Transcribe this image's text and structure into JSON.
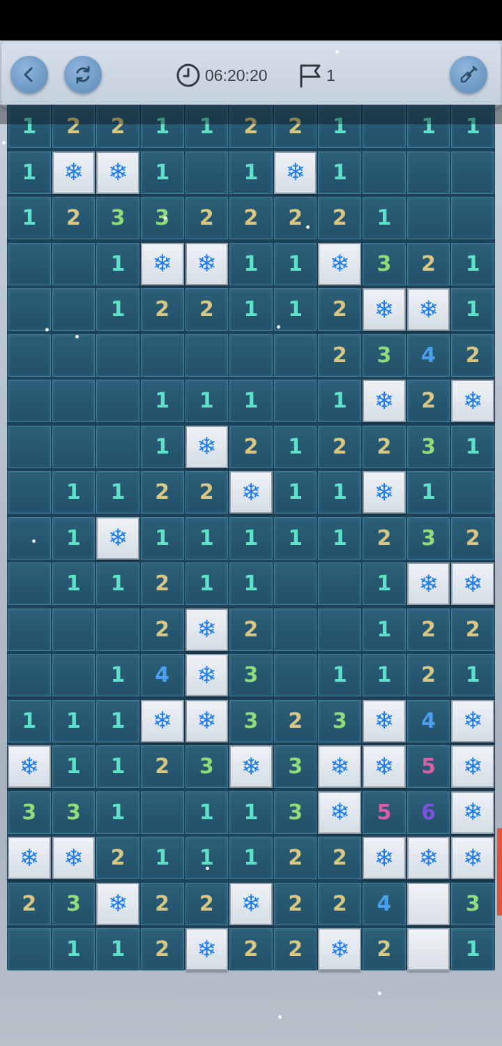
{
  "toolbar": {
    "back_icon": "chevron-left-icon",
    "restart_icon": "refresh-icon",
    "timer_icon": "clock-icon",
    "timer": "06:20:20",
    "flag_icon": "flag-icon",
    "flag_count": "1",
    "tool_icon": "shovel-icon"
  },
  "board": {
    "columns": 11,
    "mine_symbol": "❄",
    "number_colors": {
      "1": "#5fe0c8",
      "2": "#d8c783",
      "3": "#8fdc7a",
      "4": "#4aa0ef",
      "5": "#d95fa6",
      "6": "#7b52df"
    },
    "rows": [
      [
        "1",
        "2",
        "2",
        "1",
        "1",
        "2",
        "2",
        "1",
        "",
        "1",
        "1"
      ],
      [
        "1",
        "M",
        "M",
        "1",
        "",
        "1",
        "M",
        "1",
        "",
        "",
        ""
      ],
      [
        "1",
        "2",
        "3",
        "3",
        "2",
        "2",
        "2",
        "2",
        "1",
        "",
        ""
      ],
      [
        "",
        "",
        "1",
        "M",
        "M",
        "1",
        "1",
        "M",
        "3",
        "2",
        "1"
      ],
      [
        "",
        "",
        "1",
        "2",
        "2",
        "1",
        "1",
        "2",
        "M",
        "M",
        "1"
      ],
      [
        "",
        "",
        "",
        "",
        "",
        "",
        "",
        "2",
        "3",
        "4",
        "2"
      ],
      [
        "",
        "",
        "",
        "1",
        "1",
        "1",
        "",
        "1",
        "M",
        "2",
        "M"
      ],
      [
        "",
        "",
        "",
        "1",
        "M",
        "2",
        "1",
        "2",
        "2",
        "3",
        "1"
      ],
      [
        "",
        "1",
        "1",
        "2",
        "2",
        "M",
        "1",
        "1",
        "M",
        "1",
        ""
      ],
      [
        "",
        "1",
        "M",
        "1",
        "1",
        "1",
        "1",
        "1",
        "2",
        "3",
        "2"
      ],
      [
        "",
        "1",
        "1",
        "2",
        "1",
        "1",
        "",
        "",
        "1",
        "M",
        "M"
      ],
      [
        "",
        "",
        "",
        "2",
        "M",
        "2",
        "",
        "",
        "1",
        "2",
        "2"
      ],
      [
        "",
        "",
        "1",
        "4",
        "M",
        "3",
        "",
        "1",
        "1",
        "2",
        "1"
      ],
      [
        "1",
        "1",
        "1",
        "M",
        "M",
        "3",
        "2",
        "3",
        "M",
        "4",
        "M"
      ],
      [
        "M",
        "1",
        "1",
        "2",
        "3",
        "M",
        "3",
        "M",
        "M",
        "5",
        "M"
      ],
      [
        "3",
        "3",
        "1",
        "",
        "1",
        "1",
        "3",
        "M",
        "5",
        "6",
        "M"
      ],
      [
        "M",
        "M",
        "2",
        "1",
        "1",
        "1",
        "2",
        "2",
        "M",
        "M",
        "M"
      ],
      [
        "2",
        "3",
        "M",
        "2",
        "2",
        "M",
        "2",
        "2",
        "4",
        "C",
        "3"
      ],
      [
        "",
        "1",
        "1",
        "2",
        "M",
        "2",
        "2",
        "M",
        "2",
        "C",
        "1"
      ]
    ]
  }
}
